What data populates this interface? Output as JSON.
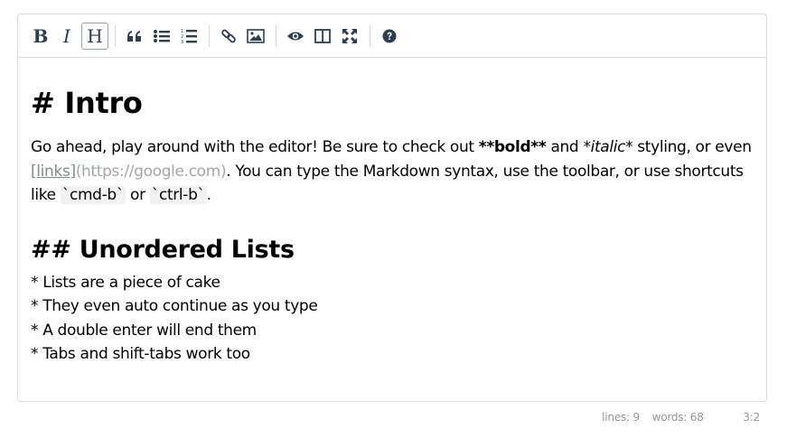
{
  "toolbar": {
    "buttons": [
      {
        "name": "bold",
        "glyph": "B",
        "icon": "bold-icon"
      },
      {
        "name": "italic",
        "glyph": "I",
        "icon": "italic-icon"
      },
      {
        "name": "heading",
        "glyph": "H",
        "icon": "heading-icon",
        "active": true
      },
      {
        "name": "quote",
        "icon": "quote-icon"
      },
      {
        "name": "unordered-list",
        "icon": "unordered-list-icon"
      },
      {
        "name": "ordered-list",
        "icon": "ordered-list-icon"
      },
      {
        "name": "link",
        "icon": "link-icon"
      },
      {
        "name": "image",
        "icon": "image-icon"
      },
      {
        "name": "preview",
        "icon": "eye-icon"
      },
      {
        "name": "side-by-side",
        "icon": "columns-icon"
      },
      {
        "name": "fullscreen",
        "icon": "expand-icon"
      },
      {
        "name": "guide",
        "icon": "question-circle-icon"
      }
    ]
  },
  "content": {
    "h1": "# Intro",
    "paragraph": {
      "l1_a": "Go ahead, play around with the editor! Be sure to check out ",
      "bold": "**bold**",
      "l1_b": " and ",
      "italic": "*italic*",
      "l1_c": " styling, or even",
      "link_text": "[links]",
      "link_url": "(https://google.com)",
      "l2_b": ". You can type the Markdown syntax, use the toolbar, or use shortcuts",
      "l3_a": "like ",
      "code1": "`cmd-b`",
      "l3_b": " or ",
      "code2": "`ctrl-b`",
      "l3_c": "."
    },
    "h2": "## Unordered Lists",
    "list": [
      "* Lists are a piece of cake",
      "* They even auto continue as you type",
      "* A double enter will end them",
      "* Tabs and shift-tabs work too"
    ]
  },
  "statusbar": {
    "lines": "lines: 9",
    "words": "words: 68",
    "cursor": "3:2"
  },
  "colors": {
    "icon": "#2c3e50",
    "border": "#dcdcdc",
    "link": "#7f8c8d",
    "status": "#959595"
  }
}
